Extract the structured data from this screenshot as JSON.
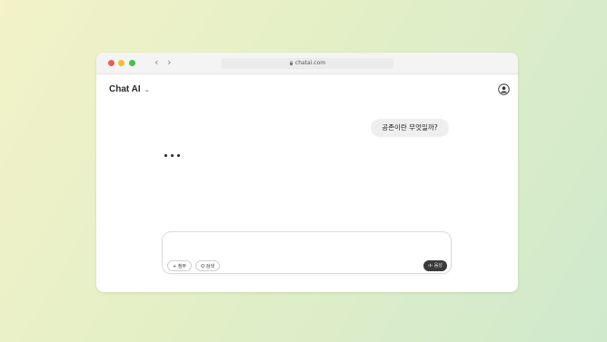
{
  "browser": {
    "url": "chatai.com",
    "back_label": "‹",
    "forward_label": "›"
  },
  "app": {
    "title": "Chat AI",
    "chevron": "⌄"
  },
  "conversation": {
    "user_message": "공존이란 무엇일까?",
    "assistant_typing": true
  },
  "composer": {
    "input_value": "",
    "attach_label": "+ 첨부",
    "search_label": "Q 검색",
    "send_label": "음성"
  },
  "icons": {
    "lock": "lock-icon",
    "avatar": "user-avatar-icon",
    "voice": "waveform-icon"
  },
  "colors": {
    "close": "#ee5b55",
    "minimize": "#f4bc2f",
    "maximize": "#43c241",
    "send_bg": "#3a3a3a"
  }
}
